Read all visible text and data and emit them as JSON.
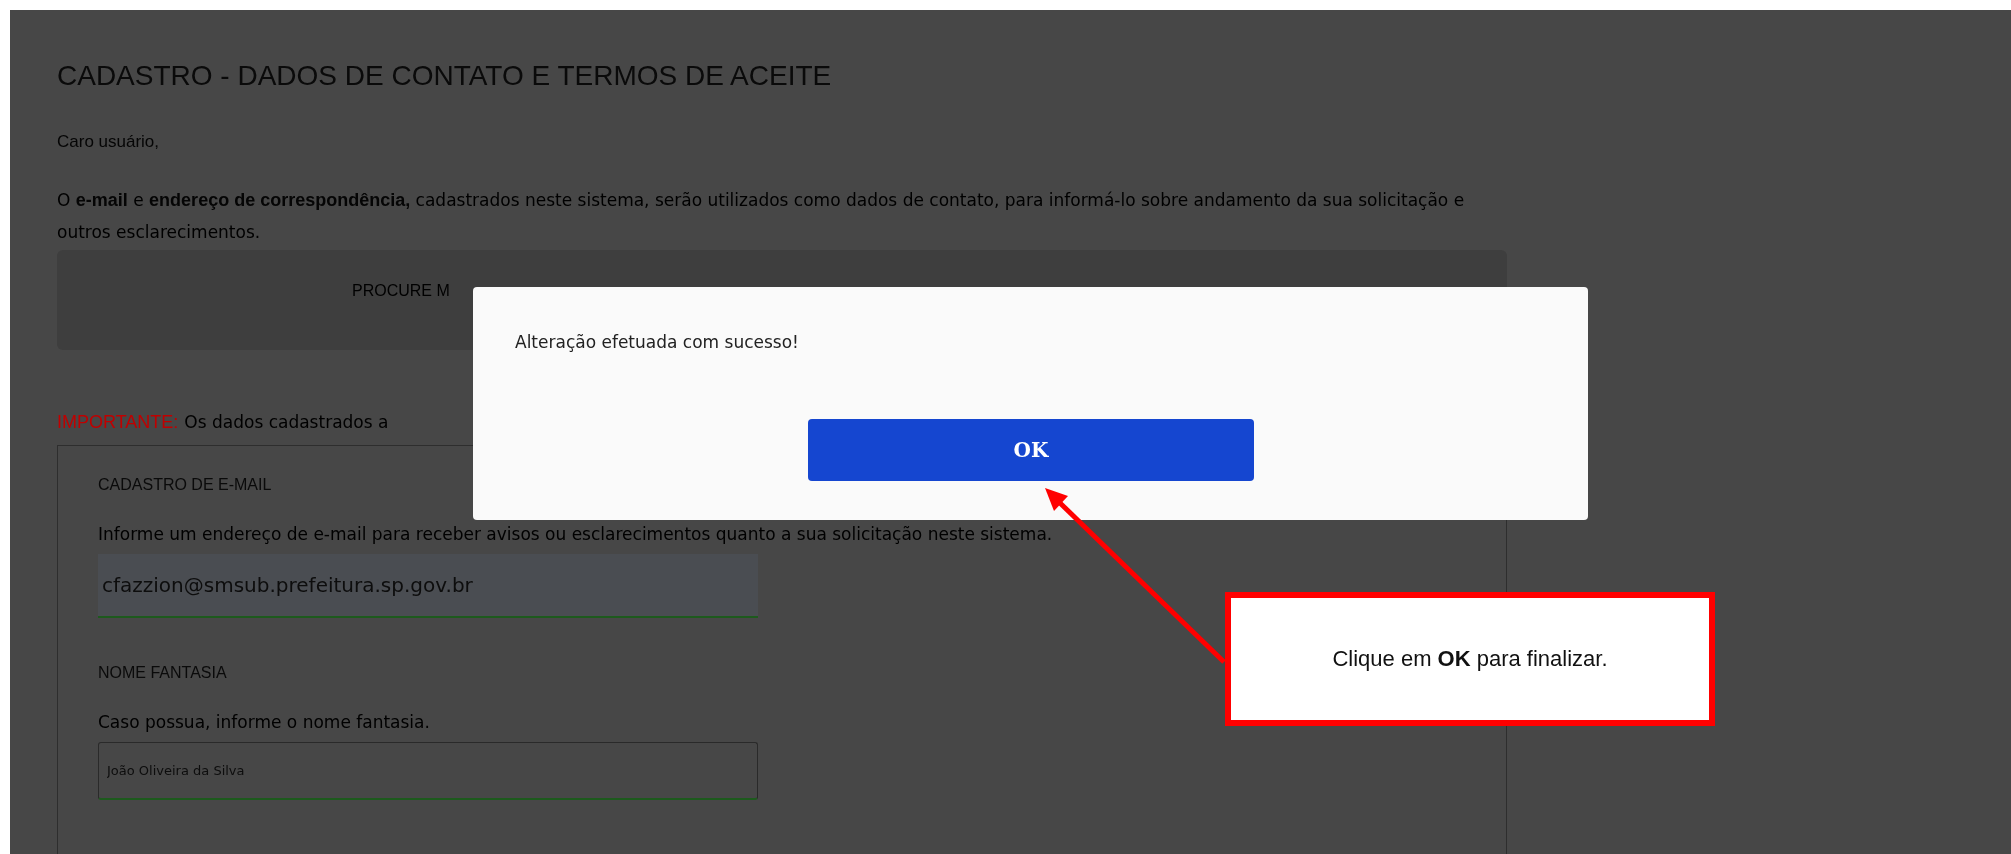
{
  "page": {
    "title": "CADASTRO - DADOS DE CONTATO E TERMOS DE ACEITE",
    "greeting": "Caro usuário,",
    "intro": "O **e-mail** e **endereço de correspondência,** cadastrados neste sistema, serão utilizados como dados de contato, para informá-lo sobre andamento da sua solicitação e outros esclarecimentos.",
    "notice": "PROCURE M",
    "important_label": "IMPORTANTE:",
    "important_text": "Os dados cadastrados a"
  },
  "sections": [
    {
      "kind": "email",
      "heading": "CADASTRO DE E-MAIL",
      "hint": "Informe um endereço de e-mail para receber avisos ou esclarecimentos quanto a sua solicitação neste sistema.",
      "value": "cfazzion@smsub.prefeitura.sp.gov.br"
    },
    {
      "kind": "text",
      "heading": "NOME FANTASIA",
      "hint": "Caso possua, informe o nome fantasia.",
      "value": "João Oliveira da Silva"
    }
  ],
  "dialog": {
    "message": "Alteração efetuada com sucesso!",
    "button": "OK"
  },
  "callout": {
    "text": "Clique em **OK** para finalizar."
  }
}
